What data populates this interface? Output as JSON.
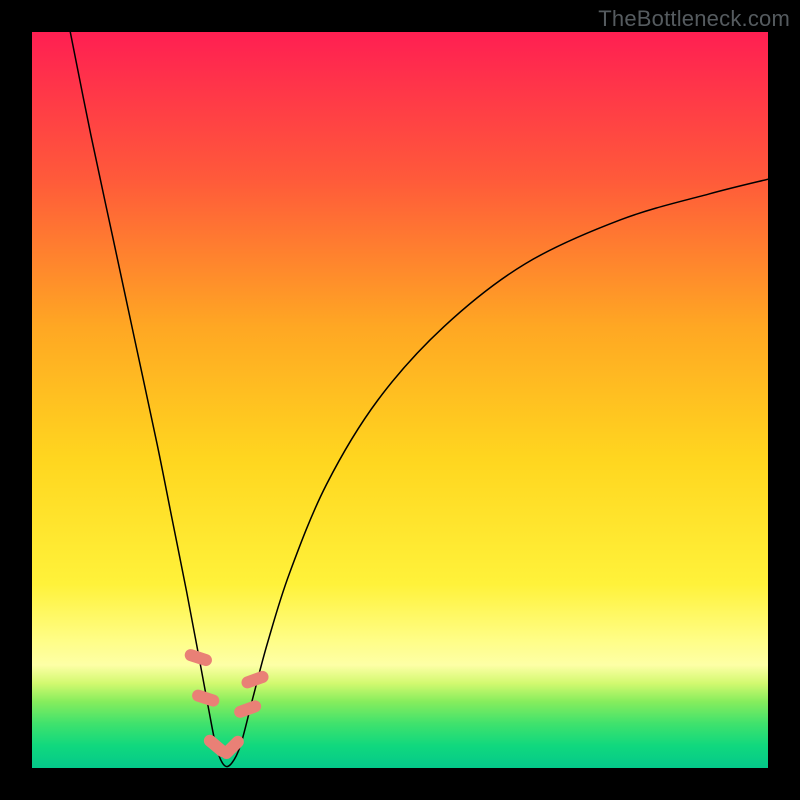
{
  "watermark": "TheBottleneck.com",
  "chart_data": {
    "type": "line",
    "title": "",
    "xlabel": "",
    "ylabel": "",
    "xlim": [
      0,
      100
    ],
    "ylim": [
      0,
      100
    ],
    "grid": false,
    "legend": false,
    "background_gradient_stops": [
      {
        "offset": 0.0,
        "color": "#ff1f52"
      },
      {
        "offset": 0.2,
        "color": "#ff5a3a"
      },
      {
        "offset": 0.4,
        "color": "#ffa723"
      },
      {
        "offset": 0.58,
        "color": "#ffd61f"
      },
      {
        "offset": 0.75,
        "color": "#fff23a"
      },
      {
        "offset": 0.83,
        "color": "#fffe8a"
      },
      {
        "offset": 0.86,
        "color": "#fdffa6"
      },
      {
        "offset": 0.885,
        "color": "#d2f96f"
      },
      {
        "offset": 0.91,
        "color": "#86ed5d"
      },
      {
        "offset": 0.94,
        "color": "#3fe26d"
      },
      {
        "offset": 0.97,
        "color": "#10d87e"
      },
      {
        "offset": 1.0,
        "color": "#04c98a"
      }
    ],
    "series": [
      {
        "name": "bottleneck-curve",
        "color": "#000000",
        "width": 1.5,
        "x": [
          5.2,
          8.0,
          11.0,
          14.0,
          17.0,
          19.0,
          21.0,
          22.7,
          24.0,
          25.0,
          26.0,
          27.0,
          28.3,
          30.0,
          32.0,
          35.0,
          40.0,
          47.0,
          56.0,
          67.0,
          80.0,
          92.0,
          100.0
        ],
        "values": [
          100,
          86.0,
          72.0,
          58.0,
          44.0,
          34.0,
          24.0,
          15.0,
          8.0,
          3.0,
          0.5,
          0.5,
          3.0,
          9.5,
          17.0,
          26.5,
          38.5,
          50.0,
          60.0,
          68.5,
          74.5,
          78.0,
          80.0
        ]
      }
    ],
    "markers": [
      {
        "name": "marker",
        "shape": "capsule",
        "color": "#e98076",
        "x": 22.6,
        "y": 15.0,
        "angle": -72
      },
      {
        "name": "marker",
        "shape": "capsule",
        "color": "#e98076",
        "x": 23.6,
        "y": 9.5,
        "angle": -72
      },
      {
        "name": "marker",
        "shape": "capsule",
        "color": "#e98076",
        "x": 25.0,
        "y": 3.0,
        "angle": -50
      },
      {
        "name": "marker",
        "shape": "capsule",
        "color": "#e98076",
        "x": 27.2,
        "y": 2.8,
        "angle": 45
      },
      {
        "name": "marker",
        "shape": "capsule",
        "color": "#e98076",
        "x": 29.3,
        "y": 8.0,
        "angle": 70
      },
      {
        "name": "marker",
        "shape": "capsule",
        "color": "#e98076",
        "x": 30.3,
        "y": 12.0,
        "angle": 70
      }
    ]
  }
}
